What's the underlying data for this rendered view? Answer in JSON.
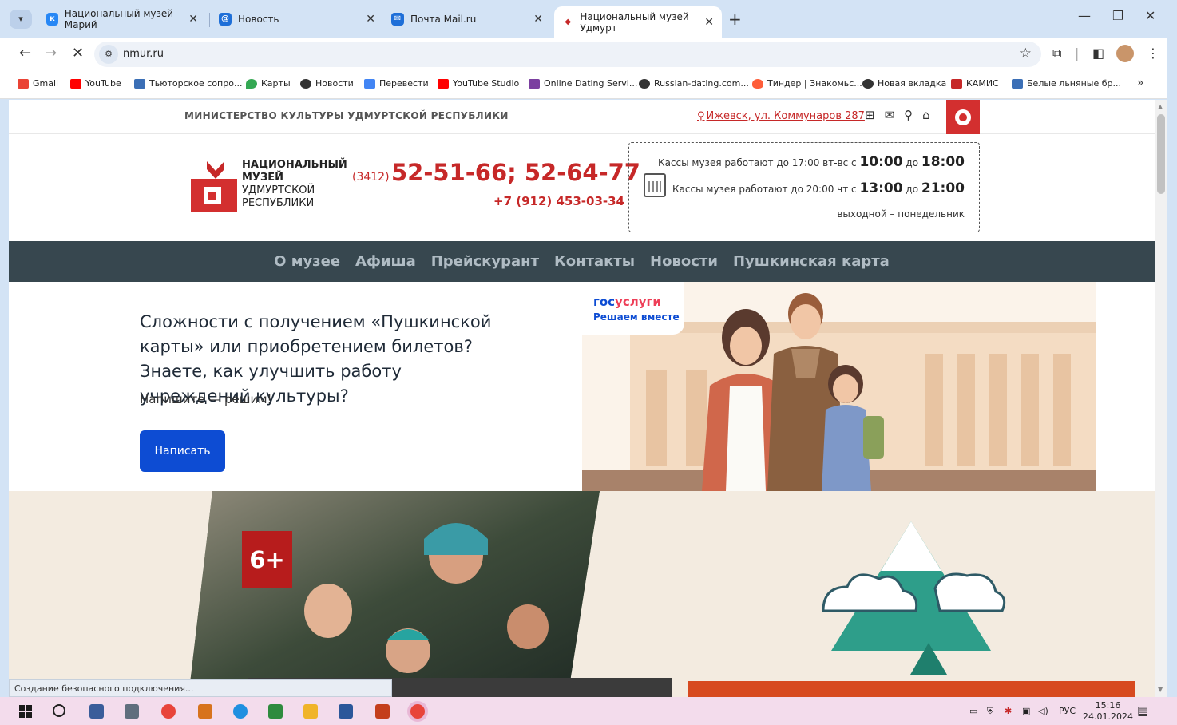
{
  "browser": {
    "tabs": [
      {
        "title": "Национальный музей Марий",
        "favicon": "vk-icon",
        "color": "#2787f5"
      },
      {
        "title": "Новость",
        "favicon": "mail-at-icon",
        "color": "#1e6fd8"
      },
      {
        "title": "Почта Mail.ru",
        "favicon": "mail-icon",
        "color": "#1e6fd8"
      },
      {
        "title": "Национальный музей Удмурт",
        "favicon": "museum-icon",
        "color": "#c62828",
        "active": true
      }
    ],
    "url": "nmur.ru",
    "bookmarks": [
      {
        "label": "Gmail",
        "color": "#ea4335"
      },
      {
        "label": "YouTube",
        "color": "#ff0000"
      },
      {
        "label": "Тьюторское сопро...",
        "color": "#3b6fb6"
      },
      {
        "label": "Карты",
        "color": "#34a853"
      },
      {
        "label": "Новости",
        "color": "#333333"
      },
      {
        "label": "Перевести",
        "color": "#4285f4"
      },
      {
        "label": "YouTube Studio",
        "color": "#ff0000"
      },
      {
        "label": "Online Dating Servi...",
        "color": "#7b3fa0"
      },
      {
        "label": "Russian-dating.com...",
        "color": "#333333"
      },
      {
        "label": "Тиндер | Знакомьс...",
        "color": "#fe5e3a"
      },
      {
        "label": "Новая вкладка",
        "color": "#333333"
      },
      {
        "label": "КАМИС",
        "color": "#c62828"
      },
      {
        "label": "Белые льняные бр...",
        "color": "#3b6fb6"
      }
    ],
    "status": "Создание безопасного подключения..."
  },
  "site": {
    "ministry": "МИНИСТЕРСТВО КУЛЬТУРЫ УДМУРТСКОЙ РЕСПУБЛИКИ",
    "address": "Ижевск, ул. Коммунаров 287",
    "logo_lines": [
      "НАЦИОНАЛЬНЫЙ",
      "МУЗЕЙ",
      "УДМУРТСКОЙ",
      "РЕСПУБЛИКИ"
    ],
    "phone_code": "(3412)",
    "phone_main": "52-51-66; 52-64-77",
    "phone_mobile": "+7 (912) 453-03-34",
    "hours": {
      "row1_text": "Кассы музея работают до 17:00 вт-вс с ",
      "row1_from": "10:00",
      "row1_mid": " до ",
      "row1_to": "18:00",
      "row2_text": "Кассы музея работают до 20:00 чт с ",
      "row2_from": "13:00",
      "row2_mid": " до ",
      "row2_to": "21:00",
      "dayoff": "выходной – понедельник"
    },
    "nav": [
      "О музее",
      "Афиша",
      "Прейскурант",
      "Контакты",
      "Новости",
      "Пушкинская карта"
    ],
    "banner": {
      "title": "Сложности с получением «Пушкинской карты» или приобретением билетов? Знаете, как улучшить работу учреждений культуры?",
      "subtitle": "Напишите — решим!",
      "button": "Написать",
      "gos_a": "гос",
      "gos_b": "услуги",
      "gos_tagline": "Решаем вместе"
    },
    "promo": {
      "age": "6+"
    }
  },
  "taskbar": {
    "lang": "РУС",
    "time": "15:16",
    "date": "24.01.2024"
  }
}
